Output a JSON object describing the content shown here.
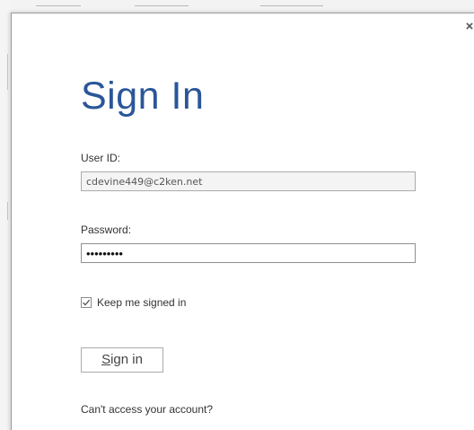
{
  "window": {
    "close_glyph": "×"
  },
  "signin": {
    "title": "Sign In",
    "user_id_label": "User ID:",
    "user_id_value": "cdevine449@c2ken.net",
    "password_label": "Password:",
    "password_value": "•••••••••",
    "keep_signed_in_label": "Keep me signed in",
    "keep_signed_in_checked": true,
    "button_access_key": "S",
    "button_rest": "ign in",
    "help_link": "Can't access your account?"
  },
  "colors": {
    "title_blue": "#2a5699",
    "text": "#333333",
    "field_border": "#ababab"
  },
  "icons": {
    "close": "close-icon",
    "checkmark": "checkmark-icon"
  }
}
